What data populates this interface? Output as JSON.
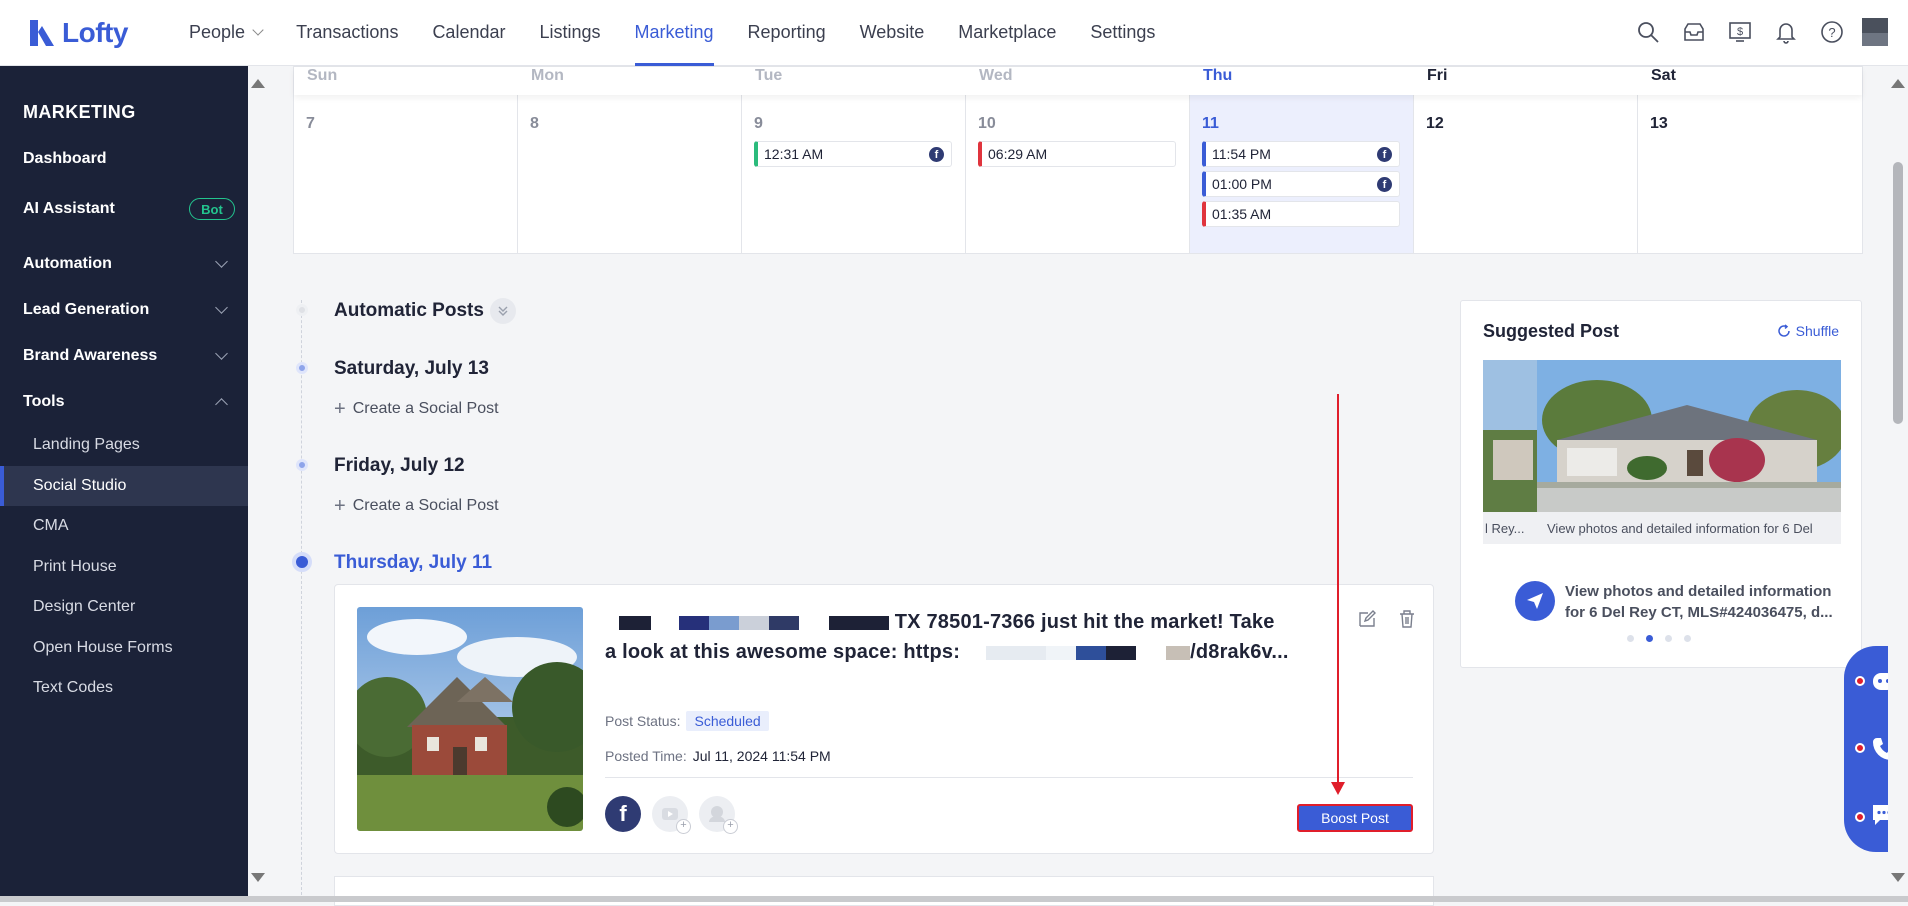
{
  "app": {
    "logo": "Lofty"
  },
  "nav": [
    {
      "label": "People",
      "dropdown": true
    },
    {
      "label": "Transactions"
    },
    {
      "label": "Calendar"
    },
    {
      "label": "Listings"
    },
    {
      "label": "Marketing",
      "active": true
    },
    {
      "label": "Reporting"
    },
    {
      "label": "Website"
    },
    {
      "label": "Marketplace"
    },
    {
      "label": "Settings"
    }
  ],
  "top_icons": [
    "search-icon",
    "inbox-icon",
    "billing-icon",
    "bell-icon",
    "help-icon",
    "avatar"
  ],
  "sidebar": {
    "title": "MARKETING",
    "dashboard": "Dashboard",
    "ai_assistant": "AI Assistant",
    "bot_badge": "Bot",
    "automation": "Automation",
    "lead_generation": "Lead Generation",
    "brand_awareness": "Brand Awareness",
    "tools": "Tools",
    "tools_items": [
      "Landing Pages",
      "Social Studio",
      "CMA",
      "Print House",
      "Design Center",
      "Open House Forms",
      "Text Codes"
    ],
    "active_item": "Social Studio"
  },
  "calendar": {
    "days": [
      "Sun",
      "Mon",
      "Tue",
      "Wed",
      "Thu",
      "Fri",
      "Sat"
    ],
    "dates": [
      "7",
      "8",
      "9",
      "10",
      "11",
      "12",
      "13"
    ],
    "today_index": 4,
    "events": {
      "tue": {
        "time": "12:31 AM",
        "color": "#2bbb7c",
        "fb": true
      },
      "wed": {
        "time": "06:29 AM",
        "color": "#e0343d",
        "fb": false
      },
      "thu": [
        {
          "time": "11:54 PM",
          "color": "#3a5cd6",
          "fb": true
        },
        {
          "time": "01:00 PM",
          "color": "#3a5cd6",
          "fb": true
        },
        {
          "time": "01:35 AM",
          "color": "#e0343d",
          "fb": false
        }
      ]
    }
  },
  "timeline": {
    "automatic_posts": "Automatic Posts",
    "sat": "Saturday, July 13",
    "fri": "Friday, July 12",
    "thu": "Thursday, July 11",
    "create_label": "Create a Social Post"
  },
  "post": {
    "text_line1_tail": "TX 78501-7366 just hit the market! Take",
    "text_line2_head": "a look at this awesome space: https:",
    "text_line2_tail": "/d8rak6v...",
    "status_label": "Post Status:",
    "status_value": "Scheduled",
    "time_label": "Posted Time:",
    "time_value": "Jul 11, 2024 11:54 PM",
    "boost_label": "Boost Post"
  },
  "suggested": {
    "title": "Suggested Post",
    "shuffle": "Shuffle",
    "caption_prev": "l Rey...",
    "caption_main": "View photos and detailed information for 6 Del",
    "caption_prev_top": "3",
    "text": "View photos and detailed information for 6 Del Rey CT, MLS#424036475, d...",
    "dots": 4,
    "active_dot": 1
  },
  "colors": {
    "accent": "#3a5cd6",
    "sidebar": "#1b2238",
    "alert": "#e01e2b",
    "success": "#23c48e"
  }
}
